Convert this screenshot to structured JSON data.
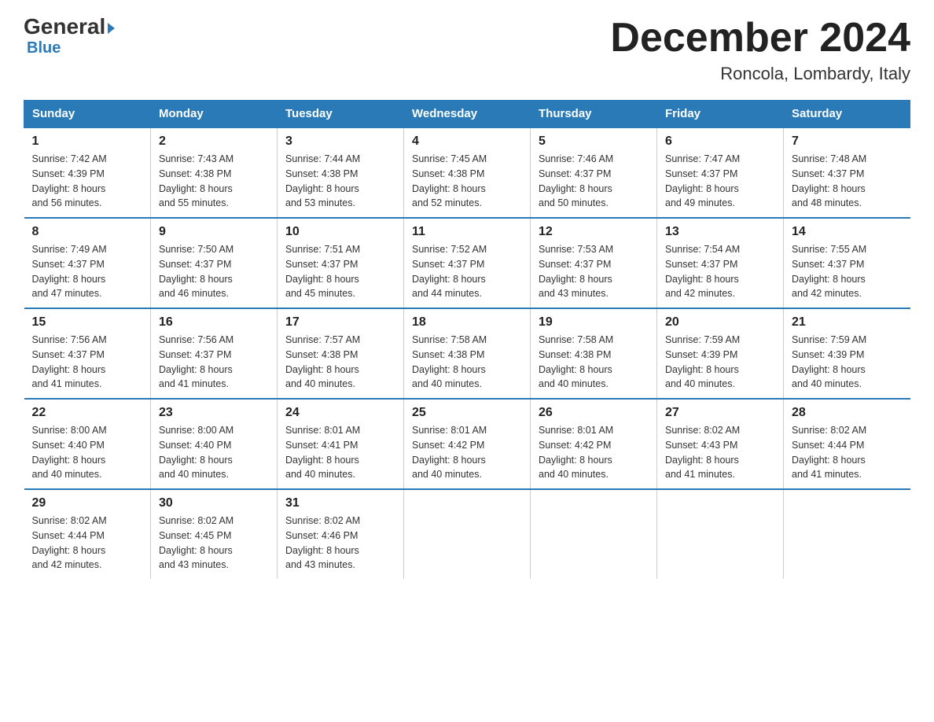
{
  "logo": {
    "general": "General",
    "blue": "Blue",
    "triangle": "▶"
  },
  "title": "December 2024",
  "subtitle": "Roncola, Lombardy, Italy",
  "days_of_week": [
    "Sunday",
    "Monday",
    "Tuesday",
    "Wednesday",
    "Thursday",
    "Friday",
    "Saturday"
  ],
  "weeks": [
    [
      {
        "day": "1",
        "sunrise": "7:42 AM",
        "sunset": "4:39 PM",
        "daylight": "8 hours and 56 minutes."
      },
      {
        "day": "2",
        "sunrise": "7:43 AM",
        "sunset": "4:38 PM",
        "daylight": "8 hours and 55 minutes."
      },
      {
        "day": "3",
        "sunrise": "7:44 AM",
        "sunset": "4:38 PM",
        "daylight": "8 hours and 53 minutes."
      },
      {
        "day": "4",
        "sunrise": "7:45 AM",
        "sunset": "4:38 PM",
        "daylight": "8 hours and 52 minutes."
      },
      {
        "day": "5",
        "sunrise": "7:46 AM",
        "sunset": "4:37 PM",
        "daylight": "8 hours and 50 minutes."
      },
      {
        "day": "6",
        "sunrise": "7:47 AM",
        "sunset": "4:37 PM",
        "daylight": "8 hours and 49 minutes."
      },
      {
        "day": "7",
        "sunrise": "7:48 AM",
        "sunset": "4:37 PM",
        "daylight": "8 hours and 48 minutes."
      }
    ],
    [
      {
        "day": "8",
        "sunrise": "7:49 AM",
        "sunset": "4:37 PM",
        "daylight": "8 hours and 47 minutes."
      },
      {
        "day": "9",
        "sunrise": "7:50 AM",
        "sunset": "4:37 PM",
        "daylight": "8 hours and 46 minutes."
      },
      {
        "day": "10",
        "sunrise": "7:51 AM",
        "sunset": "4:37 PM",
        "daylight": "8 hours and 45 minutes."
      },
      {
        "day": "11",
        "sunrise": "7:52 AM",
        "sunset": "4:37 PM",
        "daylight": "8 hours and 44 minutes."
      },
      {
        "day": "12",
        "sunrise": "7:53 AM",
        "sunset": "4:37 PM",
        "daylight": "8 hours and 43 minutes."
      },
      {
        "day": "13",
        "sunrise": "7:54 AM",
        "sunset": "4:37 PM",
        "daylight": "8 hours and 42 minutes."
      },
      {
        "day": "14",
        "sunrise": "7:55 AM",
        "sunset": "4:37 PM",
        "daylight": "8 hours and 42 minutes."
      }
    ],
    [
      {
        "day": "15",
        "sunrise": "7:56 AM",
        "sunset": "4:37 PM",
        "daylight": "8 hours and 41 minutes."
      },
      {
        "day": "16",
        "sunrise": "7:56 AM",
        "sunset": "4:37 PM",
        "daylight": "8 hours and 41 minutes."
      },
      {
        "day": "17",
        "sunrise": "7:57 AM",
        "sunset": "4:38 PM",
        "daylight": "8 hours and 40 minutes."
      },
      {
        "day": "18",
        "sunrise": "7:58 AM",
        "sunset": "4:38 PM",
        "daylight": "8 hours and 40 minutes."
      },
      {
        "day": "19",
        "sunrise": "7:58 AM",
        "sunset": "4:38 PM",
        "daylight": "8 hours and 40 minutes."
      },
      {
        "day": "20",
        "sunrise": "7:59 AM",
        "sunset": "4:39 PM",
        "daylight": "8 hours and 40 minutes."
      },
      {
        "day": "21",
        "sunrise": "7:59 AM",
        "sunset": "4:39 PM",
        "daylight": "8 hours and 40 minutes."
      }
    ],
    [
      {
        "day": "22",
        "sunrise": "8:00 AM",
        "sunset": "4:40 PM",
        "daylight": "8 hours and 40 minutes."
      },
      {
        "day": "23",
        "sunrise": "8:00 AM",
        "sunset": "4:40 PM",
        "daylight": "8 hours and 40 minutes."
      },
      {
        "day": "24",
        "sunrise": "8:01 AM",
        "sunset": "4:41 PM",
        "daylight": "8 hours and 40 minutes."
      },
      {
        "day": "25",
        "sunrise": "8:01 AM",
        "sunset": "4:42 PM",
        "daylight": "8 hours and 40 minutes."
      },
      {
        "day": "26",
        "sunrise": "8:01 AM",
        "sunset": "4:42 PM",
        "daylight": "8 hours and 40 minutes."
      },
      {
        "day": "27",
        "sunrise": "8:02 AM",
        "sunset": "4:43 PM",
        "daylight": "8 hours and 41 minutes."
      },
      {
        "day": "28",
        "sunrise": "8:02 AM",
        "sunset": "4:44 PM",
        "daylight": "8 hours and 41 minutes."
      }
    ],
    [
      {
        "day": "29",
        "sunrise": "8:02 AM",
        "sunset": "4:44 PM",
        "daylight": "8 hours and 42 minutes."
      },
      {
        "day": "30",
        "sunrise": "8:02 AM",
        "sunset": "4:45 PM",
        "daylight": "8 hours and 43 minutes."
      },
      {
        "day": "31",
        "sunrise": "8:02 AM",
        "sunset": "4:46 PM",
        "daylight": "8 hours and 43 minutes."
      },
      null,
      null,
      null,
      null
    ]
  ]
}
